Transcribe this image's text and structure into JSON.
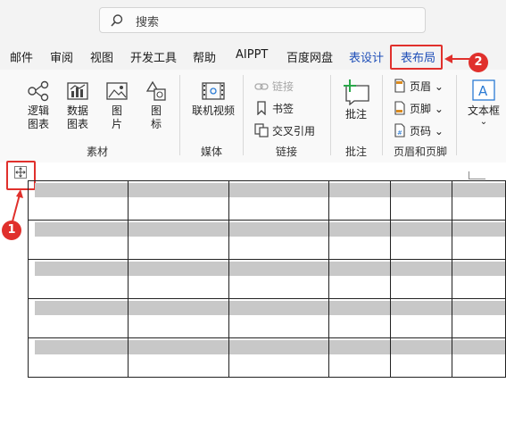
{
  "search": {
    "placeholder": "搜索"
  },
  "tabs": [
    "邮件",
    "审阅",
    "视图",
    "开发工具",
    "帮助",
    "AIPPT",
    "百度网盘",
    "表设计",
    "表布局"
  ],
  "ribbon": {
    "material": {
      "label": "素材",
      "items": [
        "逻辑\n图表",
        "数据\n图表",
        "图\n片",
        "图\n标"
      ]
    },
    "media": {
      "label": "媒体",
      "item": "联机视频"
    },
    "links": {
      "label": "链接",
      "items": [
        "链接",
        "书签",
        "交叉引用"
      ]
    },
    "comments": {
      "label": "批注",
      "item": "批注"
    },
    "header_footer": {
      "label": "页眉和页脚",
      "items": [
        "页眉",
        "页脚",
        "页码"
      ]
    },
    "textbox": {
      "label": "文本框"
    }
  },
  "callouts": {
    "one": "1",
    "two": "2"
  },
  "colors": {
    "accent_red": "#e0302c",
    "tab_blue": "#1f4fb8",
    "shade": "#c8c8c8"
  },
  "icons": [
    "search-icon",
    "logic-chart-icon",
    "data-chart-icon",
    "picture-icon",
    "shapes-icon",
    "video-icon",
    "link-icon",
    "bookmark-icon",
    "cross-ref-icon",
    "comment-icon",
    "header-icon",
    "footer-icon",
    "page-number-icon",
    "textbox-icon",
    "move-handle-icon"
  ]
}
